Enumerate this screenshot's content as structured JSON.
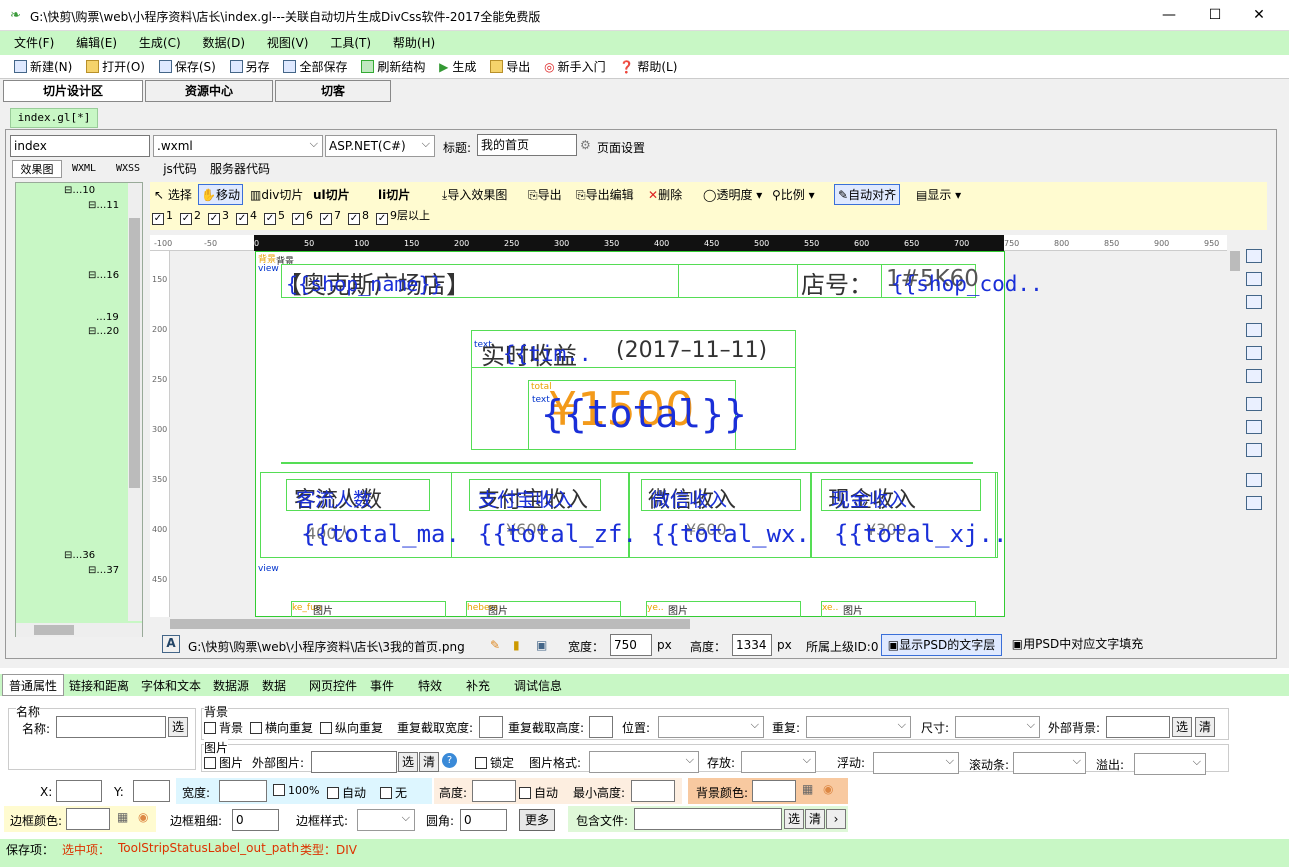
{
  "title": "G:\\快剪\\购票\\web\\小程序资料\\店长\\index.gl---关联自动切片生成DivCss软件-2017全能免费版",
  "window_controls": {
    "minimize": "—",
    "maximize": "☐",
    "close": "✕"
  },
  "menu": [
    "文件(F)",
    "编辑(E)",
    "生成(C)",
    "数据(D)",
    "视图(V)",
    "工具(T)",
    "帮助(H)"
  ],
  "toolbar": [
    "新建(N)",
    "打开(O)",
    "保存(S)",
    "另存",
    "全部保存",
    "刷新结构",
    "生成",
    "导出",
    "新手入门",
    "帮助(L)"
  ],
  "big_tabs": [
    "切片设计区",
    "资源中心",
    "切客"
  ],
  "file_tab": "index.gl[*]",
  "page_name": "index",
  "format_select": ".wxml",
  "lang_select": "ASP.NET(C#)",
  "title_label": "标题:",
  "title_value": "我的首页",
  "page_settings": "页面设置",
  "sub_tabs": [
    "效果图",
    "WXML",
    "WXSS",
    "js代码",
    "服务器代码"
  ],
  "tree_nodes": [
    "10",
    "11",
    "16",
    "19",
    "20",
    "36",
    "37"
  ],
  "design_tools": [
    "选择",
    "移动",
    "div切片",
    "ul切片",
    "li切片",
    "导入效果图",
    "导出",
    "导出编辑",
    "删除",
    "透明度",
    "比例",
    "自动对齐",
    "显示"
  ],
  "layer_checks": [
    "1",
    "2",
    "3",
    "4",
    "5",
    "6",
    "7",
    "8",
    "9层以上"
  ],
  "ruler_ticks": [
    "-100",
    "-50",
    "0",
    "50",
    "100",
    "150",
    "200",
    "250",
    "300",
    "350",
    "400",
    "450",
    "500",
    "550",
    "600",
    "650",
    "700",
    "750",
    "800",
    "850",
    "900",
    "950"
  ],
  "vruler_ticks": [
    "150",
    "200",
    "250",
    "300",
    "350",
    "400",
    "450"
  ],
  "canvas": {
    "bg_label": "背景",
    "view_label": "view",
    "shop_name_bg": "【奥克斯广场店】",
    "shop_name_var": "{{shop_name}}",
    "shop_code_label": "店号：",
    "shop_code_bg": "1#5K60",
    "shop_code_var": "{{shop_cod..",
    "realtime_bg": "实时收益",
    "realtime_date": "(2017–11–11)",
    "realtime_var": "{{tim..",
    "total_bg": "¥1500",
    "total_var": "{{total}}",
    "total_tiny": "total",
    "text_tiny": "text",
    "cards": [
      {
        "label_bg": "客流人数",
        "label": "客流人数",
        "value_bg": "400人",
        "value_var": "{{total_ma."
      },
      {
        "label_bg": "支付宝收入",
        "label": "支付宝收入",
        "value_bg": "¥600",
        "value_var": "{{total_zf."
      },
      {
        "label_bg": "微信收入",
        "label": "微信收入",
        "value_bg": "¥600",
        "value_var": "{{total_wx."
      },
      {
        "label_bg": "现金收入",
        "label": "现金收入",
        "value_bg": "¥300",
        "value_var": "{{total_xj.."
      }
    ],
    "images": [
      "图片",
      "图片",
      "图片",
      "图片"
    ],
    "img_tiny": [
      "ke_fun",
      "hebers",
      "ye..",
      "xe.."
    ]
  },
  "status": {
    "path": "G:\\快剪\\购票\\web\\小程序资料\\店长\\3我的首页.png",
    "width_label": "宽度：",
    "width_value": "750",
    "px": "px",
    "height_label": "高度：",
    "height_value": "1334",
    "parent_id": "所属上级ID:0",
    "show_psd_text": "显示PSD的文字层",
    "fill_psd_text": "用PSD中对应文字填充"
  },
  "prop_tabs": [
    "普通属性",
    "链接和距离",
    "字体和文本",
    "数据源",
    "数据",
    "网页控件",
    "事件",
    "特效",
    "补充",
    "调试信息"
  ],
  "props": {
    "name_group": "名称",
    "name_label": "名称:",
    "select_btn": "选",
    "clear_btn": "清",
    "bg_group": "背景",
    "bg_check": "背景",
    "repeat_x": "横向重复",
    "repeat_y": "纵向重复",
    "repeat_w": "重复截取宽度:",
    "repeat_h": "重复截取高度:",
    "position": "位置:",
    "repeat": "重复:",
    "size": "尺寸:",
    "outer_bg": "外部背景:",
    "img_group": "图片",
    "img_check": "图片",
    "outer_img": "外部图片:",
    "lock": "锁定",
    "img_format": "图片格式:",
    "store": "存放:",
    "float": "浮动:",
    "scroll": "滚动条:",
    "overflow": "溢出:",
    "x": "X:",
    "y": "Y:",
    "width": "宽度:",
    "pct100": "100%",
    "auto": "自动",
    "none": "无",
    "height": "高度:",
    "auto2": "自动",
    "min_height": "最小高度:",
    "bg_color": "背景颜色:",
    "border_color": "边框颜色:",
    "border_width": "边框粗细:",
    "border_width_val": "0",
    "border_style": "边框样式:",
    "radius": "圆角:",
    "radius_val": "0",
    "more": "更多",
    "include_file": "包含文件:",
    "arrow": "›"
  },
  "statusbar": {
    "save_item": "保存项：",
    "selected": "选中项：",
    "path_label": "ToolStripStatusLabel_out_path",
    "type": "类型：DIV"
  },
  "colors": {
    "accent_green": "#c8f7c5",
    "var_blue": "#1a2fd8",
    "bg_orange": "#f39a1a",
    "box_green": "#5d5"
  }
}
